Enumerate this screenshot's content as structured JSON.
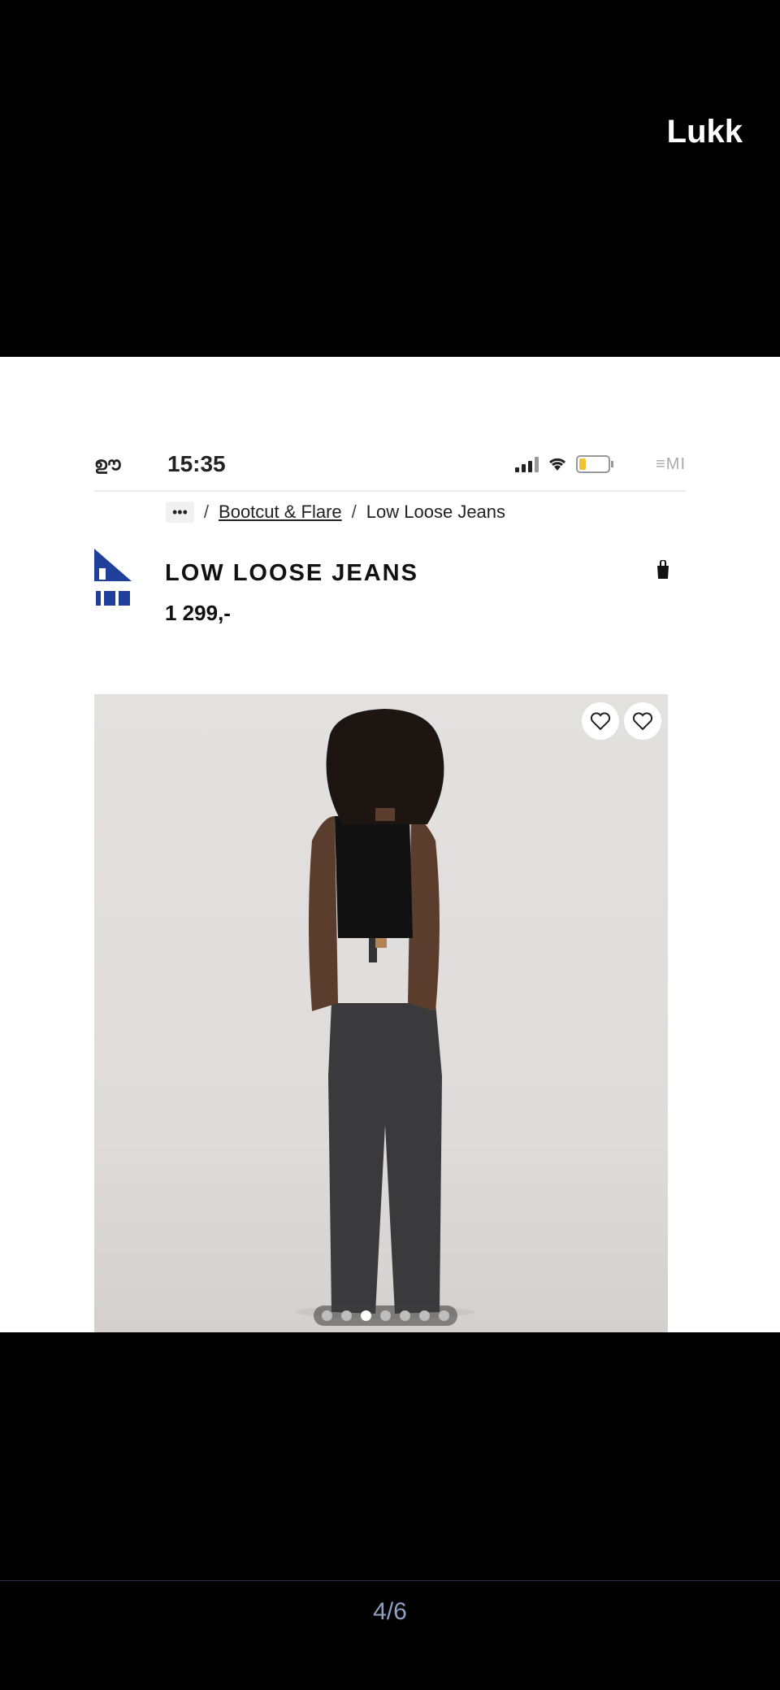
{
  "close_label": "Lukk",
  "pager": "4/6",
  "screenshot": {
    "status_bar": {
      "left": "ഊ",
      "time": "15:35",
      "right": "≡MI"
    },
    "breadcrumb": {
      "more": "•••",
      "separator": "/",
      "category": "Bootcut & Flare",
      "current": "Low Loose Jeans"
    },
    "product": {
      "title": "LOW LOOSE JEANS",
      "price": "1 299,-"
    },
    "carousel": {
      "total": 7,
      "active_index": 2
    }
  },
  "colors": {
    "background": "#000000",
    "pager_text": "#8ea0c4",
    "brand_blue": "#1f3f9a"
  }
}
